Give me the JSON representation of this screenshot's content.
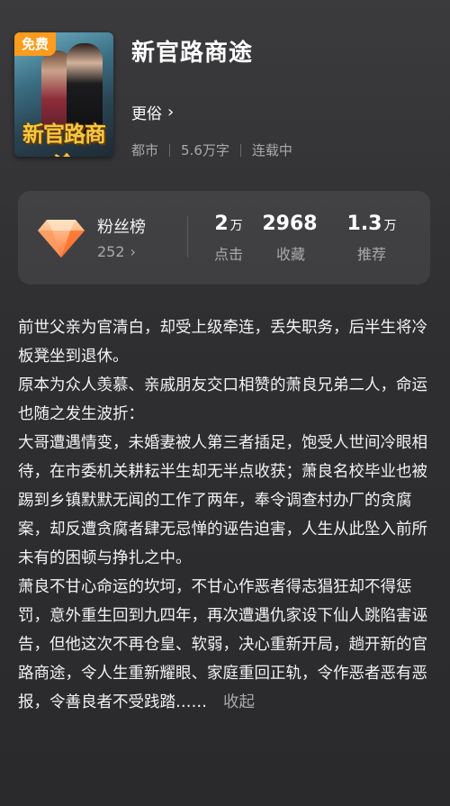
{
  "book": {
    "free_badge": "免费",
    "cover_title": "新官路商途",
    "title": "新官路商途",
    "author": "更俗",
    "author_chevron": "›",
    "category": "都市",
    "word_count": "5.6万字",
    "status": "连载中"
  },
  "stats": {
    "fans_label": "粉丝榜",
    "fans_count": "252",
    "fans_chevron": "›",
    "items": [
      {
        "value": "2",
        "unit": "万",
        "label": "点击"
      },
      {
        "value": "2968",
        "unit": "",
        "label": "收藏"
      },
      {
        "value": "1.3",
        "unit": "万",
        "label": "推荐"
      }
    ]
  },
  "description": {
    "paragraphs": [
      "前世父亲为官清白，却受上级牵连，丢失职务，后半生将冷板凳坐到退休。",
      "原本为众人羡慕、亲戚朋友交口相赞的萧良兄弟二人，命运也随之发生波折：",
      "大哥遭遇情变，未婚妻被人第三者插足，饱受人世间冷眼相待，在市委机关耕耘半生却无半点收获；萧良名校毕业也被踢到乡镇默默无闻的工作了两年，奉令调查村办厂的贪腐案，却反遭贪腐者肆无忌惮的诬告迫害，人生从此坠入前所未有的困顿与挣扎之中。",
      "萧良不甘心命运的坎坷，不甘心作恶者得志猖狂却不得惩罚，意外重生回到九四年，再次遭遇仇家设下仙人跳陷害诬告，但他这次不再仓皇、软弱，决心重新开局，趟开新的官路商途，令人生重新耀眼、家庭重回正轨，令作恶者恶有恶报，令善良者不受践踏……"
    ],
    "collapse_label": "收起"
  },
  "colors": {
    "badge": "#ff9b1d",
    "gem": "#ff8a4c"
  }
}
